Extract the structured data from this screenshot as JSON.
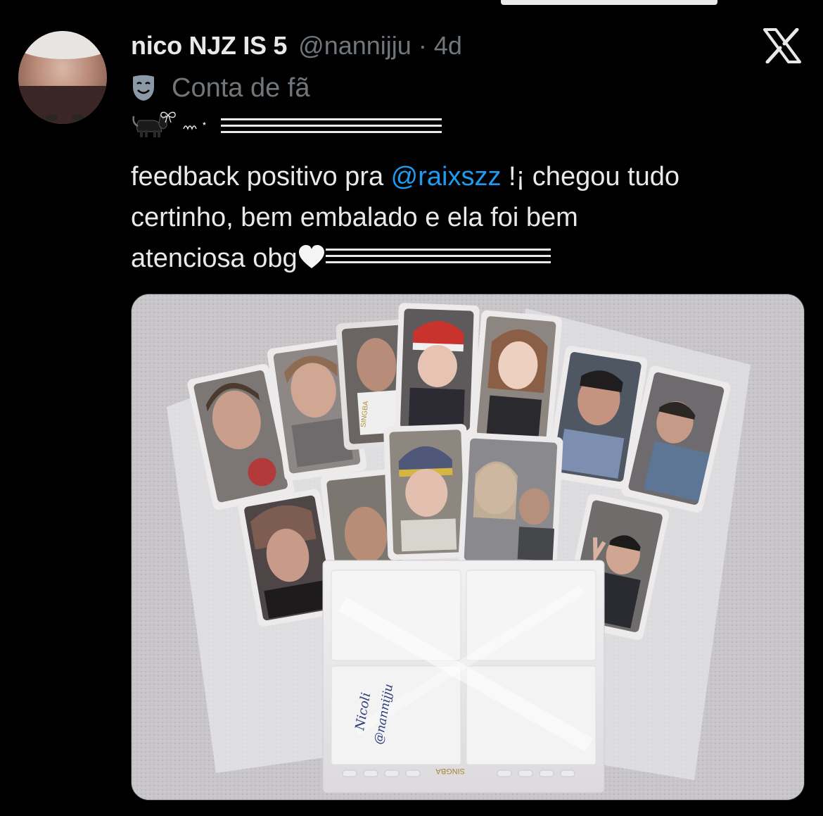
{
  "tweet": {
    "display_name": "nico NJZ IS 5",
    "handle": "@nannijju",
    "separator": "·",
    "time": "4d",
    "fan_label": "Conta de fã",
    "sparkle": "⋆",
    "text_line1_prefix": "feedback positivo pra ",
    "mention": "@raixszz",
    "text_line1_suffix": " !¡ chegou tudo",
    "text_line2": "certinho, bem embalado e ela foi bem",
    "text_line3": "atenciosa obg"
  },
  "media": {
    "binder_label_1": "SINGBA",
    "binder_label_2": "SINGBA",
    "handwriting_1": "Nicoli",
    "handwriting_2": "@nannijju"
  },
  "icons": {
    "top": "x-logo-icon",
    "fan": "theater-mask-icon",
    "emoji": [
      "black-cat-icon",
      "bow-icon"
    ],
    "heart": "white-heart-icon"
  },
  "colors": {
    "background": "#000000",
    "text": "#e7e9ea",
    "secondary": "#71767b",
    "link": "#1d9bf0"
  }
}
